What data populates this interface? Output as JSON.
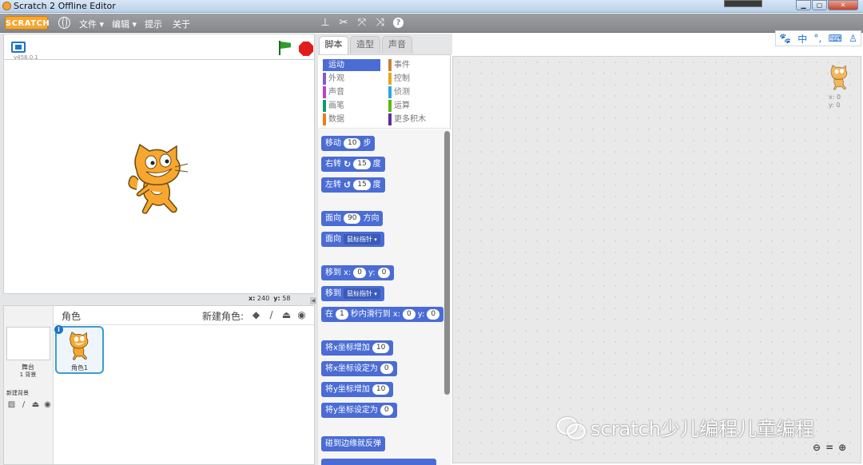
{
  "window": {
    "title": "Scratch 2 Offline Editor"
  },
  "menubar": {
    "logo": "SCRATCH",
    "file": "文件 ▾",
    "edit": "编辑 ▾",
    "tips": "提示",
    "about": "关于"
  },
  "stage": {
    "version": "v458.0.1",
    "coords": {
      "x_label": "x:",
      "x": "240",
      "y_label": "y:",
      "y": "58"
    }
  },
  "sprites_panel": {
    "label": "角色",
    "new_sprite": "新建角色:",
    "stage_name": "舞台",
    "stage_backdrops": "1 背景",
    "new_backdrop": "新建背景",
    "sprite_name": "角色1"
  },
  "tabs": [
    {
      "label": "脚本",
      "active": true
    },
    {
      "label": "造型",
      "active": false
    },
    {
      "label": "声音",
      "active": false
    }
  ],
  "categories": [
    {
      "label": "运动",
      "color": "#4a6cd4",
      "active": true
    },
    {
      "label": "事件",
      "color": "#c88330"
    },
    {
      "label": "外观",
      "color": "#8a55d7"
    },
    {
      "label": "控制",
      "color": "#e1a91a"
    },
    {
      "label": "声音",
      "color": "#bb42c3"
    },
    {
      "label": "侦测",
      "color": "#2ca5e2"
    },
    {
      "label": "画笔",
      "color": "#0e9a6c"
    },
    {
      "label": "运算",
      "color": "#5cb712"
    },
    {
      "label": "数据",
      "color": "#ee7d16"
    },
    {
      "label": "更多积木",
      "color": "#632d99"
    }
  ],
  "blocks": {
    "move": {
      "pre": "移动",
      "val": "10",
      "post": "步"
    },
    "turn_right": {
      "pre": "右转",
      "val": "15",
      "post": "度"
    },
    "turn_left": {
      "pre": "左转",
      "val": "15",
      "post": "度"
    },
    "point_dir": {
      "pre": "面向",
      "val": "90",
      "post": "方向"
    },
    "point_towards": {
      "pre": "面向",
      "drop": "鼠标指针"
    },
    "goto_xy": {
      "pre": "移到",
      "x_label": "x:",
      "x": "0",
      "y_label": "y:",
      "y": "0"
    },
    "goto": {
      "pre": "移到",
      "drop": "鼠标指针"
    },
    "glide": {
      "pre": "在",
      "sec": "1",
      "mid": "秒内滑行到",
      "x_label": "x:",
      "x": "0",
      "y_label": "y:",
      "y": "0"
    },
    "change_x": {
      "pre": "将x坐标增加",
      "val": "10"
    },
    "set_x": {
      "pre": "将x坐标设定为",
      "val": "0"
    },
    "change_y": {
      "pre": "将y坐标增加",
      "val": "10"
    },
    "set_y": {
      "pre": "将y坐标设定为",
      "val": "0"
    },
    "bounce": {
      "pre": "碰到边缘就反弹"
    }
  },
  "script_area": {
    "x": "x: 0",
    "y": "y: 0",
    "watermark": "scratch少儿编程儿童编程"
  },
  "ime": {
    "paw": "🐾",
    "lang": "中",
    "punct": "°,",
    "user": "♙"
  }
}
